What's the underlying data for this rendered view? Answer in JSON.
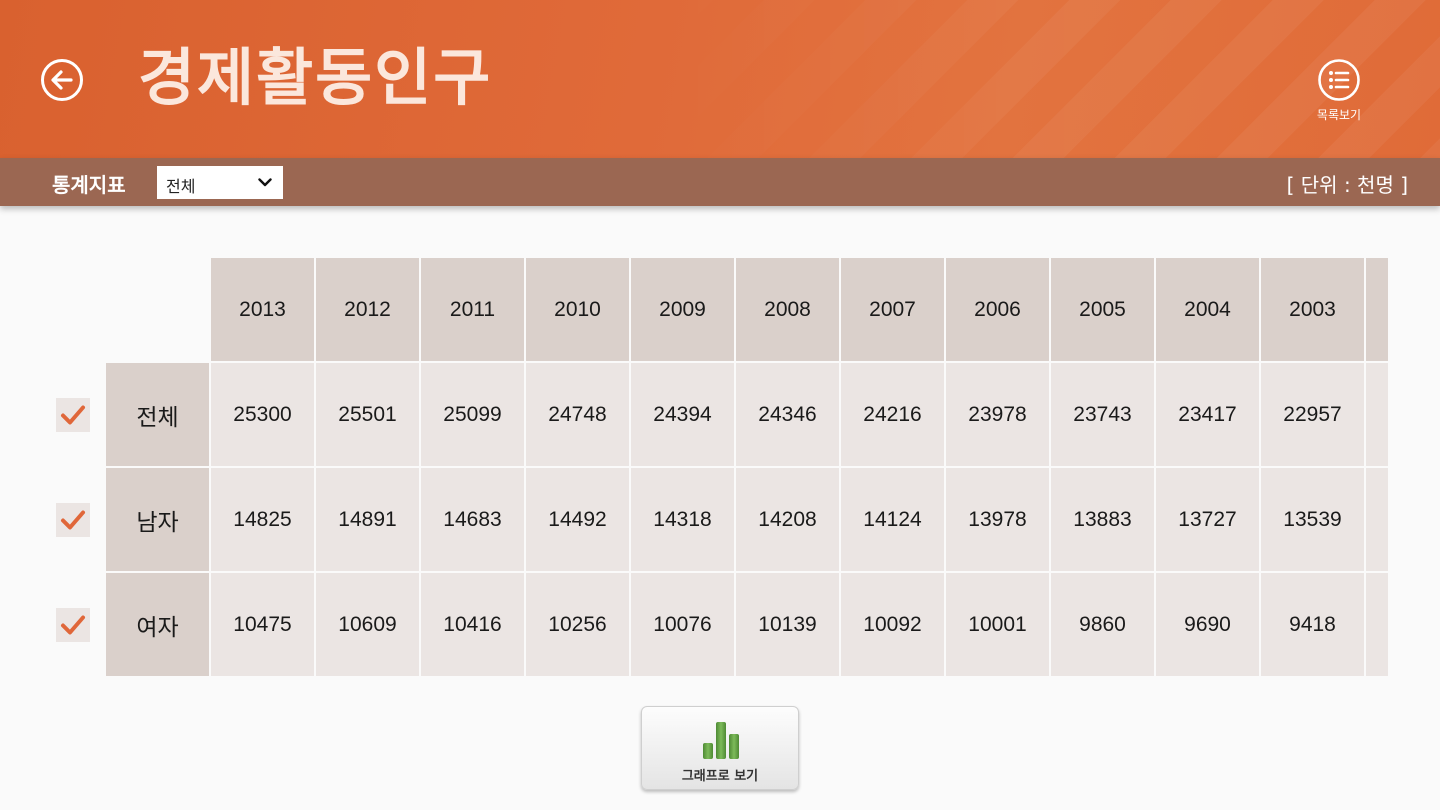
{
  "header": {
    "title": "경제활동인구",
    "back_icon": "arrow-left-circle-icon",
    "list_view_label": "목록보기",
    "list_view_icon": "list-circle-icon"
  },
  "filter": {
    "label": "통계지표",
    "selected": "전체",
    "unit": "[ 단위 : 천명 ]"
  },
  "table": {
    "years": [
      "2013",
      "2012",
      "2011",
      "2010",
      "2009",
      "2008",
      "2007",
      "2006",
      "2005",
      "2004",
      "2003"
    ],
    "rows": [
      {
        "label": "전체",
        "checked": true,
        "values": [
          "25300",
          "25501",
          "25099",
          "24748",
          "24394",
          "24346",
          "24216",
          "23978",
          "23743",
          "23417",
          "22957"
        ]
      },
      {
        "label": "남자",
        "checked": true,
        "values": [
          "14825",
          "14891",
          "14683",
          "14492",
          "14318",
          "14208",
          "14124",
          "13978",
          "13883",
          "13727",
          "13539"
        ]
      },
      {
        "label": "여자",
        "checked": true,
        "values": [
          "10475",
          "10609",
          "10416",
          "10256",
          "10076",
          "10139",
          "10092",
          "10001",
          "9860",
          "9690",
          "9418"
        ]
      }
    ]
  },
  "graph_button": {
    "label": "그래프로 보기",
    "icon": "bar-chart-icon"
  },
  "colors": {
    "header": "#e06a39",
    "filterbar": "#9b6752",
    "header_cell": "#dad0cb",
    "data_cell": "#ebe5e3",
    "check": "#e0673a",
    "chart_icon": "#5a9a3c"
  }
}
